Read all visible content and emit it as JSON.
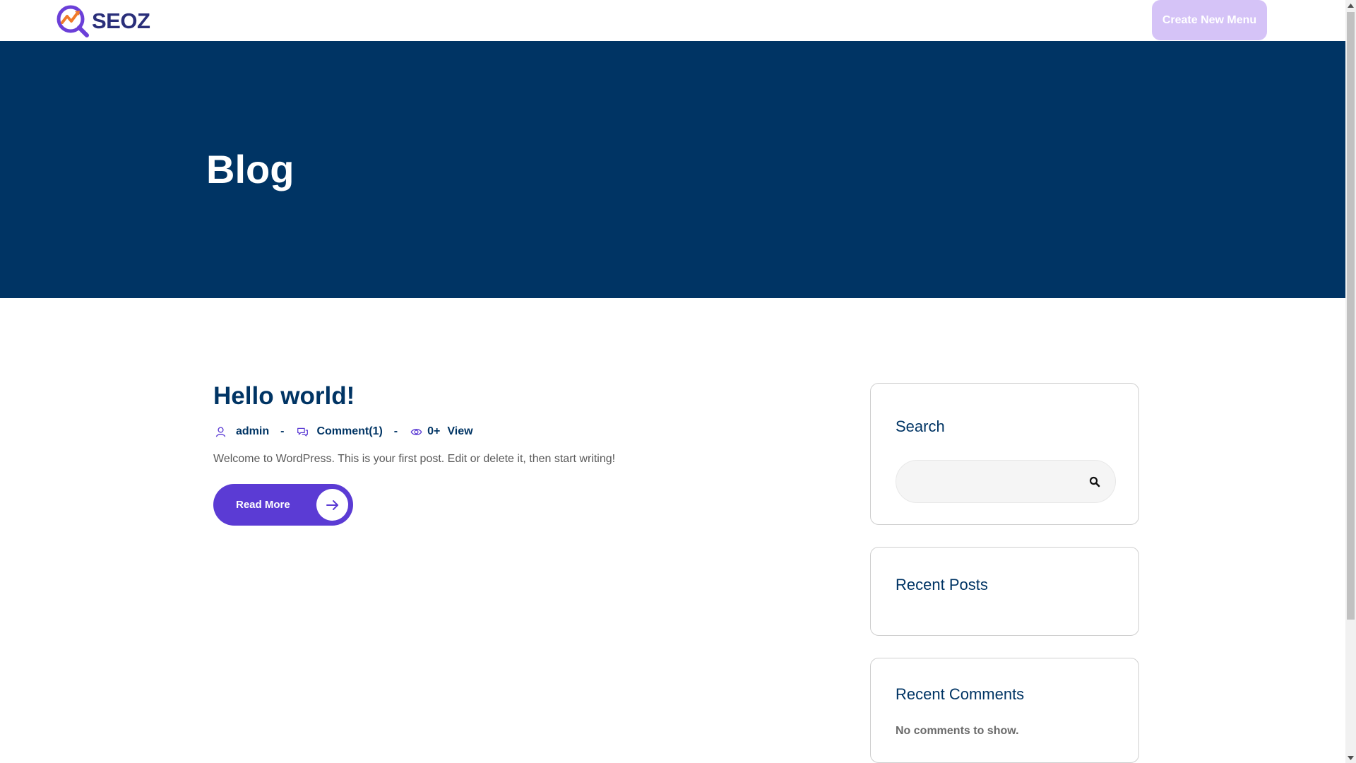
{
  "header": {
    "logo_text": "SEOZ",
    "cta_label": "Create New Menu"
  },
  "banner": {
    "title": "Blog"
  },
  "post": {
    "title": "Hello world!",
    "author": "admin",
    "separator": "-",
    "comments": "Comment(1)",
    "views_count": "0+",
    "views_label": "View",
    "excerpt": "Welcome to WordPress. This is your first post. Edit or delete it, then start writing!",
    "read_more_label": "Read More"
  },
  "sidebar": {
    "search_title": "Search",
    "search_value": "",
    "recent_posts_title": "Recent Posts",
    "recent_comments_title": "Recent Comments",
    "no_comments_text": "No comments to show."
  },
  "colors": {
    "navy": "#003464",
    "purple": "#5b3bd4",
    "cta_bg": "#d5c3f7",
    "orange_accent": "#f07a2a"
  },
  "icons": {
    "logo": "seoz-logo-icon",
    "author": "user-icon",
    "comments": "comments-icon",
    "views": "eye-icon",
    "read_more": "arrow-right-icon",
    "search": "search-icon"
  }
}
